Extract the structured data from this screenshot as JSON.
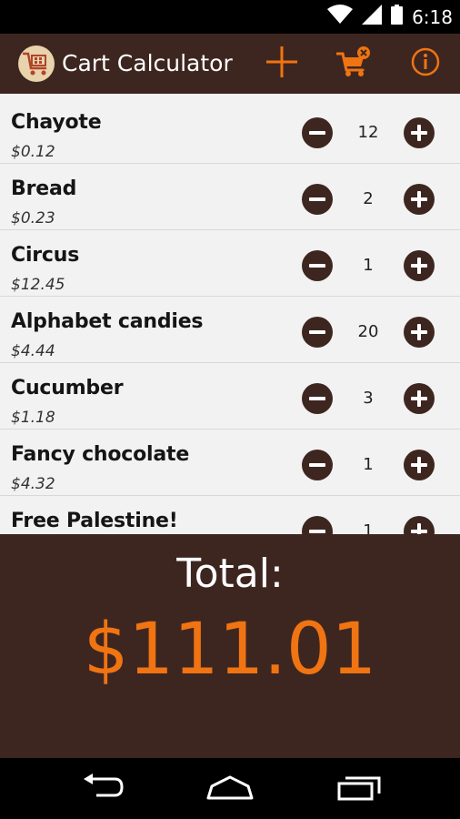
{
  "status_bar": {
    "time": "6:18",
    "wifi_icon": "wifi-icon",
    "signal_icon": "signal-icon",
    "battery_icon": "battery-icon"
  },
  "action_bar": {
    "title": "Cart Calculator",
    "logo_icon": "cart-logo-icon",
    "actions": [
      "add-icon",
      "clear-cart-icon",
      "info-icon"
    ],
    "accent_color": "#f07412",
    "background": "#3e2620"
  },
  "items": [
    {
      "name": "Chayote",
      "price": "$0.12",
      "qty": "12"
    },
    {
      "name": "Bread",
      "price": "$0.23",
      "qty": "2"
    },
    {
      "name": "Circus",
      "price": "$12.45",
      "qty": "1"
    },
    {
      "name": "Alphabet candies",
      "price": "$4.44",
      "qty": "20"
    },
    {
      "name": "Cucumber",
      "price": "$1.18",
      "qty": "3"
    },
    {
      "name": "Fancy chocolate",
      "price": "$4.32",
      "qty": "1"
    },
    {
      "name": "Free Palestine!",
      "price": "",
      "qty": "1"
    }
  ],
  "total": {
    "label": "Total:",
    "value": "$111.01"
  },
  "nav_bar": {
    "buttons": [
      "back-icon",
      "home-icon",
      "recents-icon"
    ]
  }
}
